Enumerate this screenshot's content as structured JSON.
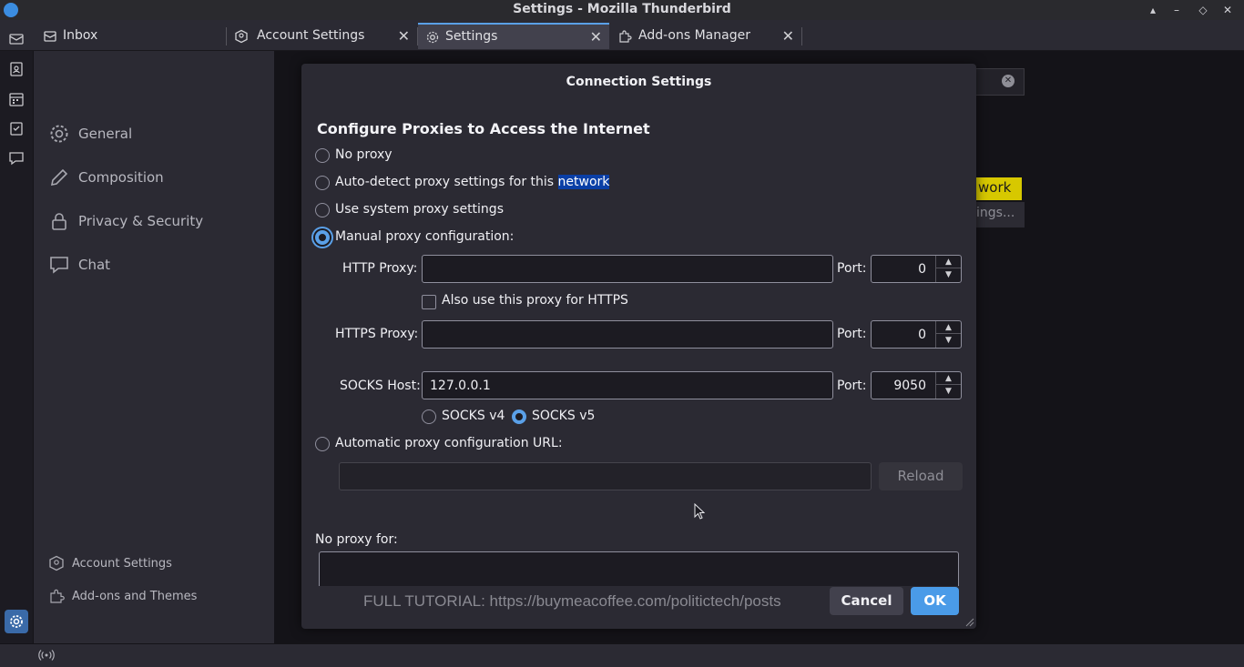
{
  "window": {
    "title": "Settings - Mozilla Thunderbird"
  },
  "tabs": [
    {
      "label": "Inbox",
      "icon": "mail-icon"
    },
    {
      "label": "Account Settings",
      "icon": "account-icon"
    },
    {
      "label": "Settings",
      "icon": "gear-icon"
    },
    {
      "label": "Add-ons Manager",
      "icon": "puzzle-icon"
    }
  ],
  "settings_nav": {
    "items": [
      {
        "label": "General",
        "icon": "gear-icon"
      },
      {
        "label": "Composition",
        "icon": "pencil-icon"
      },
      {
        "label": "Privacy & Security",
        "icon": "lock-icon"
      },
      {
        "label": "Chat",
        "icon": "chat-icon"
      }
    ],
    "bottom": [
      {
        "label": "Account Settings",
        "icon": "account-icon"
      },
      {
        "label": "Add-ons and Themes",
        "icon": "puzzle-icon"
      }
    ]
  },
  "background": {
    "highlight_text": "work",
    "button_text": "ings..."
  },
  "dialog": {
    "title": "Connection Settings",
    "section_title": "Configure Proxies to Access the Internet",
    "options": {
      "no_proxy": "No proxy",
      "auto_detect_prefix": "Auto-detect proxy settings for this ",
      "auto_detect_highlight": "network",
      "system": "Use system proxy settings",
      "manual": "Manual proxy configuration:",
      "auto_url": "Automatic proxy configuration URL:"
    },
    "selected_option": "manual",
    "http": {
      "label": "HTTP Proxy:",
      "value": "",
      "port_label": "Port:",
      "port": "0"
    },
    "also_https": {
      "label": "Also use this proxy for HTTPS",
      "checked": false
    },
    "https": {
      "label": "HTTPS Proxy:",
      "value": "",
      "port_label": "Port:",
      "port": "0"
    },
    "socks": {
      "label": "SOCKS Host:",
      "value": "127.0.0.1",
      "port_label": "Port:",
      "port": "9050",
      "v4": "SOCKS v4",
      "v5": "SOCKS v5",
      "selected": "v5"
    },
    "auto_url_value": "",
    "reload": "Reload",
    "no_proxy_for": {
      "label": "No proxy for:",
      "value": ""
    },
    "overlay_text": "FULL TUTORIAL: https://buymeacoffee.com/politictech/posts",
    "cancel": "Cancel",
    "ok": "OK"
  },
  "colors": {
    "accent": "#5aa0e8",
    "ok_button": "#4a9be8",
    "highlight": "#d7c800"
  }
}
